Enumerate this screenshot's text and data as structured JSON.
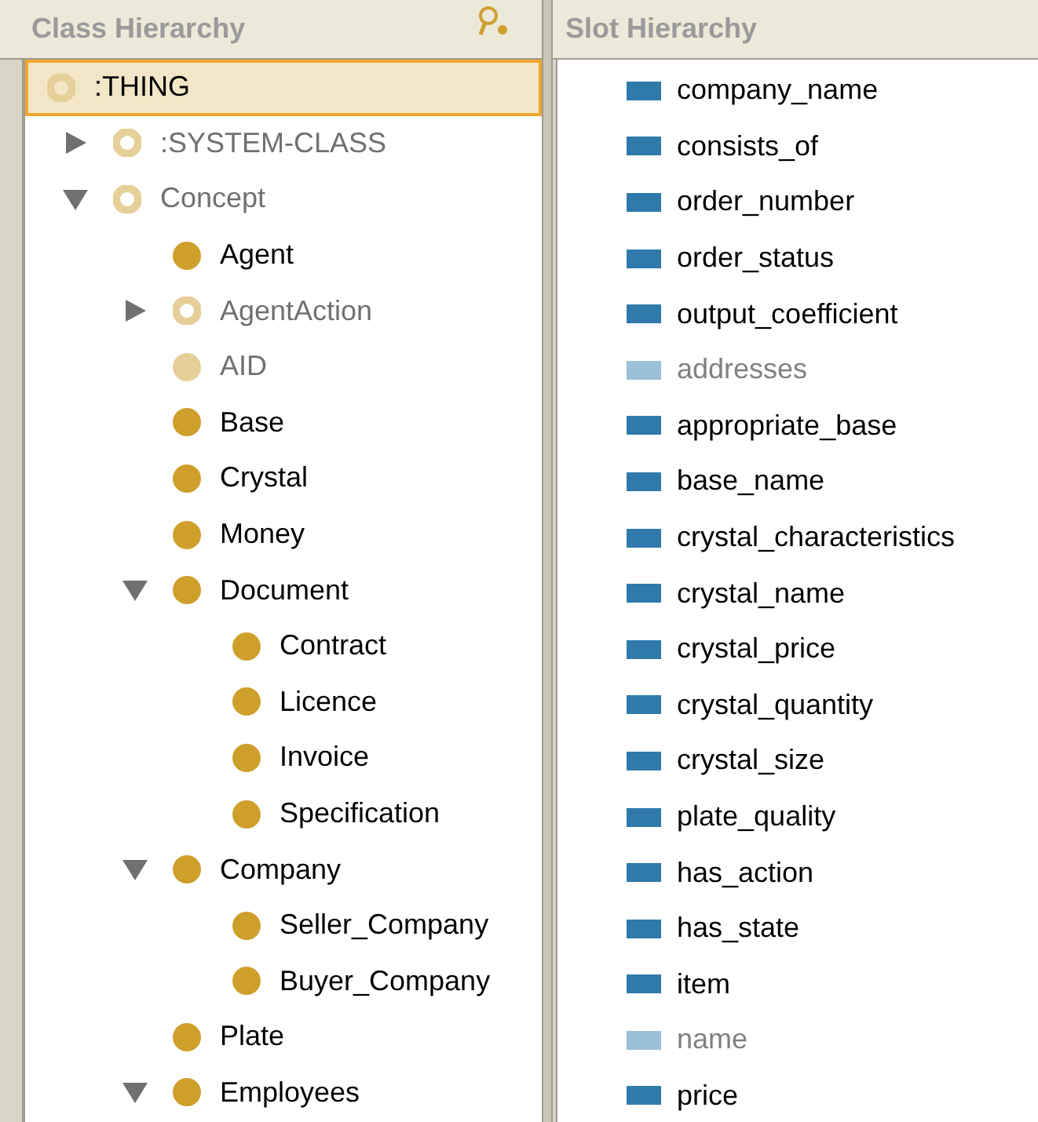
{
  "class_panel": {
    "title": "Class Hierarchy",
    "tree": [
      {
        "label": ":THING",
        "kind": "system",
        "selected": true,
        "children": [
          {
            "label": ":SYSTEM-CLASS",
            "kind": "system",
            "selected": false,
            "expanded": false
          },
          {
            "label": "Concept",
            "kind": "system",
            "selected": false,
            "expanded": true,
            "children": [
              {
                "label": "Agent",
                "kind": "concrete",
                "selected": false
              },
              {
                "label": "AgentAction",
                "kind": "system",
                "selected": false,
                "expanded": false
              },
              {
                "label": "AID",
                "kind": "abstract",
                "selected": false
              },
              {
                "label": "Base",
                "kind": "concrete",
                "selected": false
              },
              {
                "label": "Crystal",
                "kind": "concrete",
                "selected": false
              },
              {
                "label": "Money",
                "kind": "concrete",
                "selected": false
              },
              {
                "label": "Document",
                "kind": "concrete",
                "selected": false,
                "expanded": true,
                "children": [
                  {
                    "label": "Contract",
                    "kind": "concrete",
                    "selected": false
                  },
                  {
                    "label": "Licence",
                    "kind": "concrete",
                    "selected": false
                  },
                  {
                    "label": "Invoice",
                    "kind": "concrete",
                    "selected": false
                  },
                  {
                    "label": "Specification",
                    "kind": "concrete",
                    "selected": false
                  }
                ]
              },
              {
                "label": "Company",
                "kind": "concrete",
                "selected": false,
                "expanded": true,
                "children": [
                  {
                    "label": "Seller_Company",
                    "kind": "concrete",
                    "selected": false
                  },
                  {
                    "label": "Buyer_Company",
                    "kind": "concrete",
                    "selected": false
                  }
                ]
              },
              {
                "label": "Plate",
                "kind": "concrete",
                "selected": false
              },
              {
                "label": "Employees",
                "kind": "concrete",
                "selected": false,
                "expanded": true
              }
            ]
          }
        ]
      }
    ]
  },
  "slot_panel": {
    "title": "Slot Hierarchy",
    "slots": [
      {
        "label": "company_name",
        "kind": "own"
      },
      {
        "label": "consists_of",
        "kind": "own"
      },
      {
        "label": "order_number",
        "kind": "own"
      },
      {
        "label": "order_status",
        "kind": "own"
      },
      {
        "label": "output_coefficient",
        "kind": "own"
      },
      {
        "label": "addresses",
        "kind": "system"
      },
      {
        "label": "appropriate_base",
        "kind": "own"
      },
      {
        "label": "base_name",
        "kind": "own"
      },
      {
        "label": "crystal_characteristics",
        "kind": "own"
      },
      {
        "label": "crystal_name",
        "kind": "own"
      },
      {
        "label": "crystal_price",
        "kind": "own"
      },
      {
        "label": "crystal_quantity",
        "kind": "own"
      },
      {
        "label": "crystal_size",
        "kind": "own"
      },
      {
        "label": "plate_quality",
        "kind": "own"
      },
      {
        "label": "has_action",
        "kind": "own"
      },
      {
        "label": "has_state",
        "kind": "own"
      },
      {
        "label": "item",
        "kind": "own"
      },
      {
        "label": "name",
        "kind": "system"
      },
      {
        "label": "price",
        "kind": "own"
      }
    ]
  }
}
